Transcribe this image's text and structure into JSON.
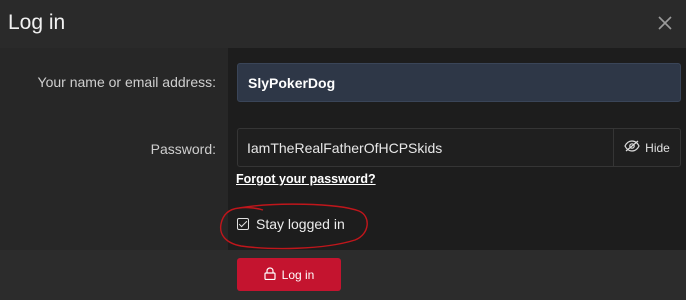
{
  "dialog": {
    "title": "Log in",
    "close_icon": "close-icon"
  },
  "form": {
    "username_label": "Your name or email address:",
    "username_value": "SlyPokerDog",
    "password_label": "Password:",
    "password_value": "IamTheRealFatherOfHCPSkids",
    "hide_label": "Hide",
    "hide_icon": "eye-slash-icon",
    "forgot_link": "Forgot your password?",
    "stay_label": "Stay logged in",
    "stay_checked": true
  },
  "footer": {
    "login_label": "Log in",
    "login_icon": "lock-icon"
  },
  "colors": {
    "accent": "#c4142f",
    "annotation": "#c0161b"
  }
}
